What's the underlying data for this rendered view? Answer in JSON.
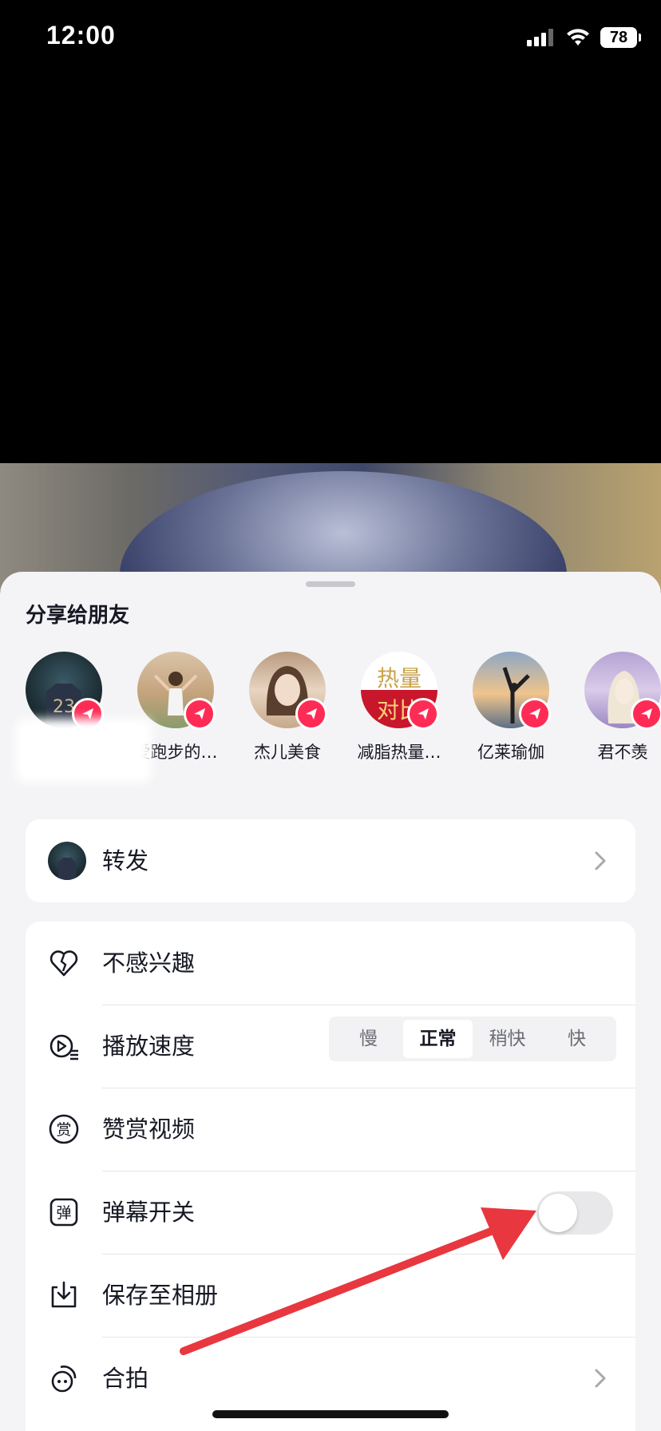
{
  "status_bar": {
    "time": "12:00",
    "battery": "78"
  },
  "sheet": {
    "title": "分享给朋友",
    "friends": [
      {
        "name": "",
        "avatar_icon": "jersey-avatar"
      },
      {
        "name": "爱跑步的…",
        "avatar_icon": "dancer-avatar"
      },
      {
        "name": "杰儿美食",
        "avatar_icon": "woman-avatar"
      },
      {
        "name": "减脂热量…",
        "avatar_icon": "text-avatar",
        "avatar_text_top": "热量",
        "avatar_text_bottom": "对比"
      },
      {
        "name": "亿莱瑜伽",
        "avatar_icon": "yoga-avatar"
      },
      {
        "name": "君不羡",
        "avatar_icon": "anime-avatar"
      }
    ],
    "forward": {
      "label": "转发"
    },
    "options": {
      "not_interested": "不感兴趣",
      "playback_speed": {
        "label": "播放速度",
        "options": [
          "慢",
          "正常",
          "稍快",
          "快"
        ],
        "selected": "正常"
      },
      "reward": "赞赏视频",
      "danmaku": {
        "label": "弹幕开关",
        "enabled": false
      },
      "save": "保存至相册",
      "duet": "合拍"
    }
  },
  "colors": {
    "accent": "#fe2c55",
    "arrow": "#e8373f",
    "sheet_bg": "#f4f4f6"
  }
}
